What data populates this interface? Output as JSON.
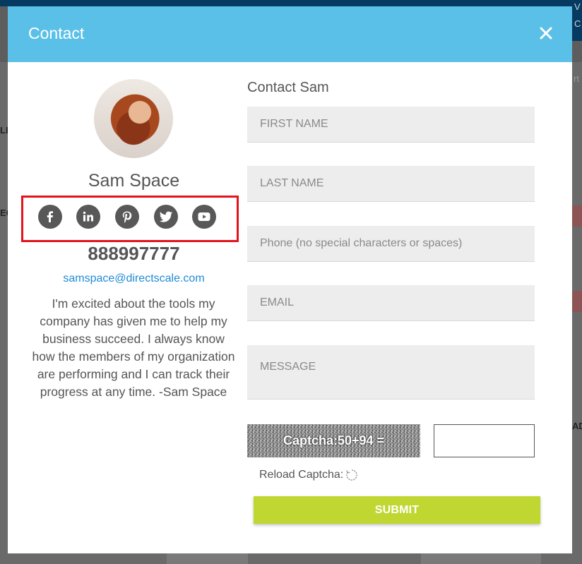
{
  "background": {
    "corner_letters": [
      "V",
      "C"
    ],
    "left_edge_fragments": [
      "LL",
      "EG"
    ],
    "right_edge_fragments": [
      "rt",
      "AD"
    ]
  },
  "modal": {
    "title": "Contact",
    "close_icon": "close-icon",
    "header_color": "#5bc0e7"
  },
  "profile": {
    "name": "Sam Space",
    "phone": "888997777",
    "email": "samspace@directscale.com",
    "bio": "I'm excited about the tools my company has given me to help my business succeed. I always know how the members of my organization are performing and I can track their progress at any time. -Sam Space",
    "social": [
      {
        "icon": "facebook-icon"
      },
      {
        "icon": "linkedin-icon"
      },
      {
        "icon": "pinterest-icon"
      },
      {
        "icon": "twitter-icon"
      },
      {
        "icon": "youtube-icon"
      }
    ],
    "highlight_color": "#e3141b"
  },
  "form": {
    "title": "Contact Sam",
    "first_name": {
      "placeholder": "FIRST NAME",
      "value": ""
    },
    "last_name": {
      "placeholder": "LAST NAME",
      "value": ""
    },
    "phone": {
      "placeholder": "Phone (no special characters or spaces)",
      "value": ""
    },
    "email": {
      "placeholder": "EMAIL",
      "value": ""
    },
    "message": {
      "placeholder": "MESSAGE",
      "value": ""
    },
    "captcha": {
      "text": "Captcha:50+94 =",
      "answer": ""
    },
    "reload_label": "Reload Captcha:",
    "submit_label": "SUBMIT",
    "submit_color": "#c0d731"
  }
}
